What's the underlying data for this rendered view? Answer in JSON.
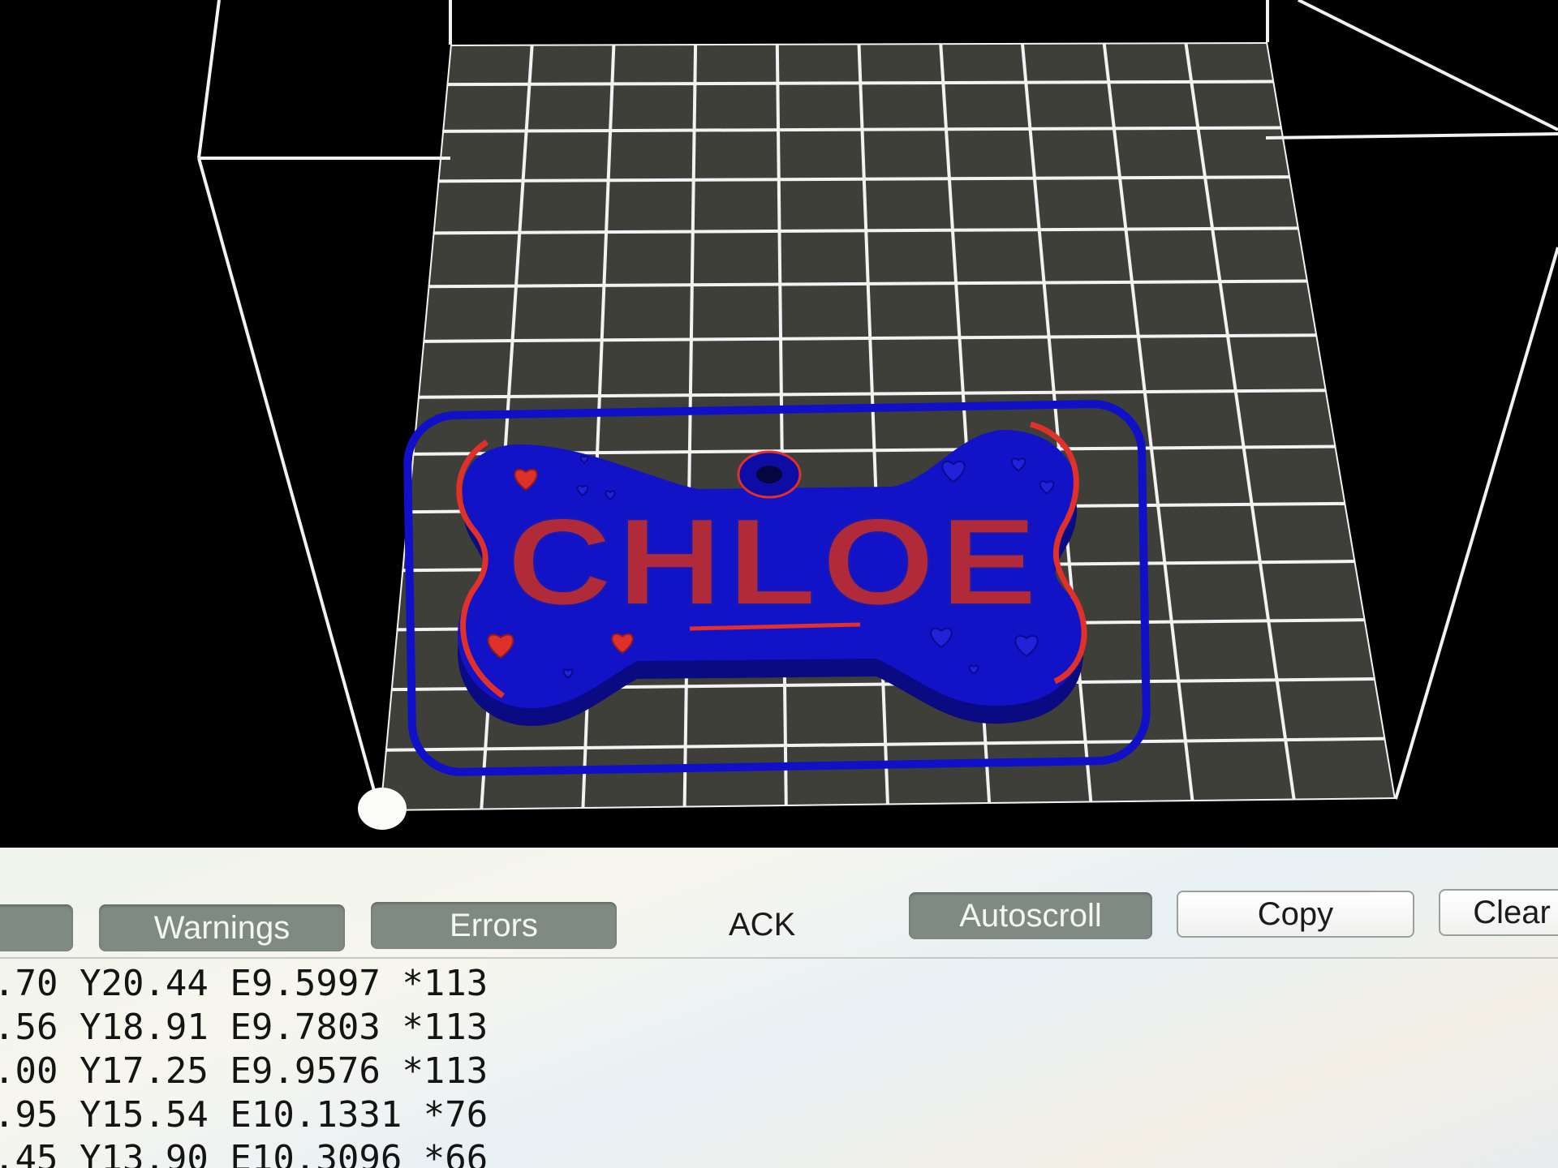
{
  "viewport": {
    "background": "#000000",
    "bed_grid_color": "#f2f2f2",
    "bed_surface_color": "#3d3f38",
    "origin_marker_color": "#ffffff",
    "model": {
      "name_text": "CHLOE",
      "body_color": "#1010c8",
      "skirt_color": "#1010c8",
      "accent_color": "#e0302a",
      "hearts": "heart-icons"
    }
  },
  "console": {
    "toolbar": {
      "buttons": [
        {
          "id": "partial",
          "label": "",
          "state": "on"
        },
        {
          "id": "warnings",
          "label": "Warnings",
          "state": "on"
        },
        {
          "id": "errors",
          "label": "Errors",
          "state": "on"
        },
        {
          "id": "ack",
          "label": "ACK",
          "state": "plain"
        },
        {
          "id": "autoscroll",
          "label": "Autoscroll",
          "state": "on"
        },
        {
          "id": "copy",
          "label": "Copy",
          "state": "off"
        },
        {
          "id": "clear",
          "label": "Clear",
          "state": "off"
        }
      ]
    },
    "log_lines": [
      ".70 Y20.44 E9.5997 *113",
      ".56 Y18.91 E9.7803 *113",
      ".00 Y17.25 E9.9576 *113",
      ".95 Y15.54 E10.1331 *76",
      ".45 Y13.90 E10.3096 *66"
    ]
  }
}
